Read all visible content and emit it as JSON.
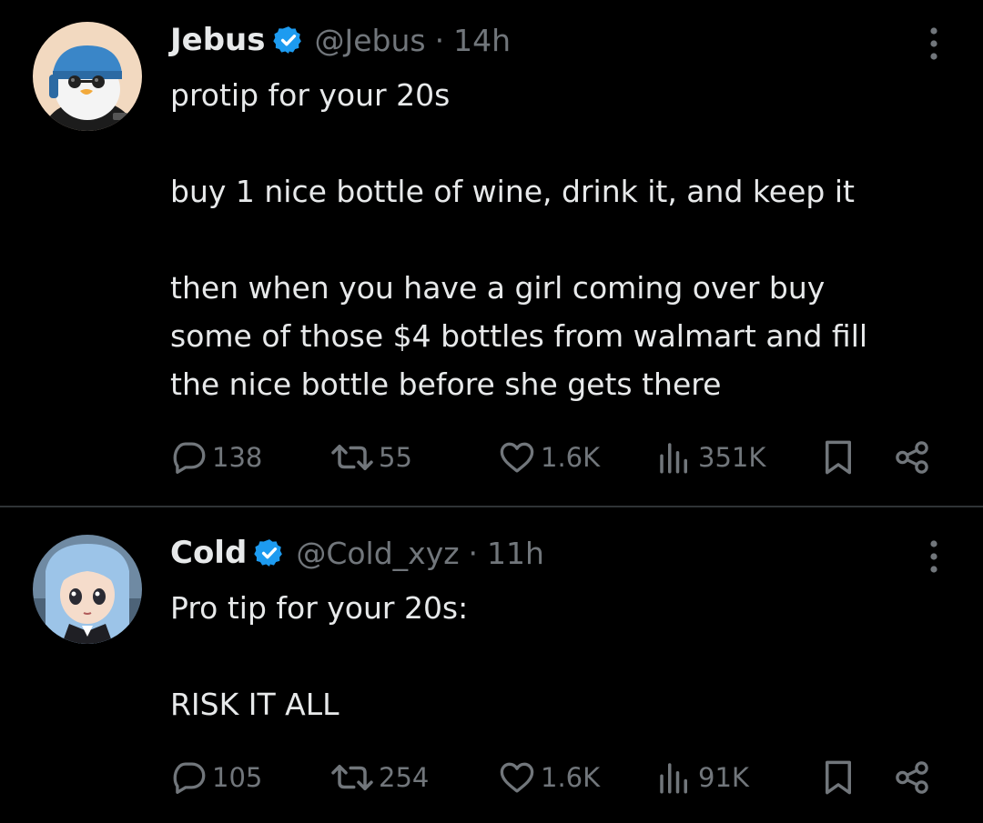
{
  "tweets": [
    {
      "author": {
        "name": "Jebus",
        "handle": "@Jebus",
        "verified": true,
        "avatar_icon": "penguin-avatar-icon"
      },
      "separator": "·",
      "time": "14h",
      "text_lines": [
        "protip for your 20s",
        "",
        "buy 1 nice bottle of wine, drink it, and keep it",
        "",
        "then when you have a girl coming over buy",
        "some of those $4 bottles from walmart and fill",
        "the nice bottle before she gets there"
      ],
      "stats": {
        "replies": "138",
        "reposts": "55",
        "likes": "1.6K",
        "views": "351K"
      }
    },
    {
      "author": {
        "name": "Cold",
        "handle": "@Cold_xyz",
        "verified": true,
        "avatar_icon": "anime-girl-avatar-icon"
      },
      "separator": "·",
      "time": "11h",
      "text_lines": [
        "Pro tip for your 20s:",
        "",
        "RISK IT ALL"
      ],
      "stats": {
        "replies": "105",
        "reposts": "254",
        "likes": "1.6K",
        "views": "91K"
      }
    }
  ],
  "icons": {
    "reply": "reply-icon",
    "repost": "repost-icon",
    "like": "heart-icon",
    "views": "views-chart-icon",
    "bookmark": "bookmark-icon",
    "share": "share-icon",
    "more": "more-vertical-icon",
    "verified": "verified-badge-icon"
  },
  "colors": {
    "background": "#000000",
    "text": "#e7e9ea",
    "muted": "#71767b",
    "verified": "#1d9bf0",
    "divider": "#2f3336"
  }
}
